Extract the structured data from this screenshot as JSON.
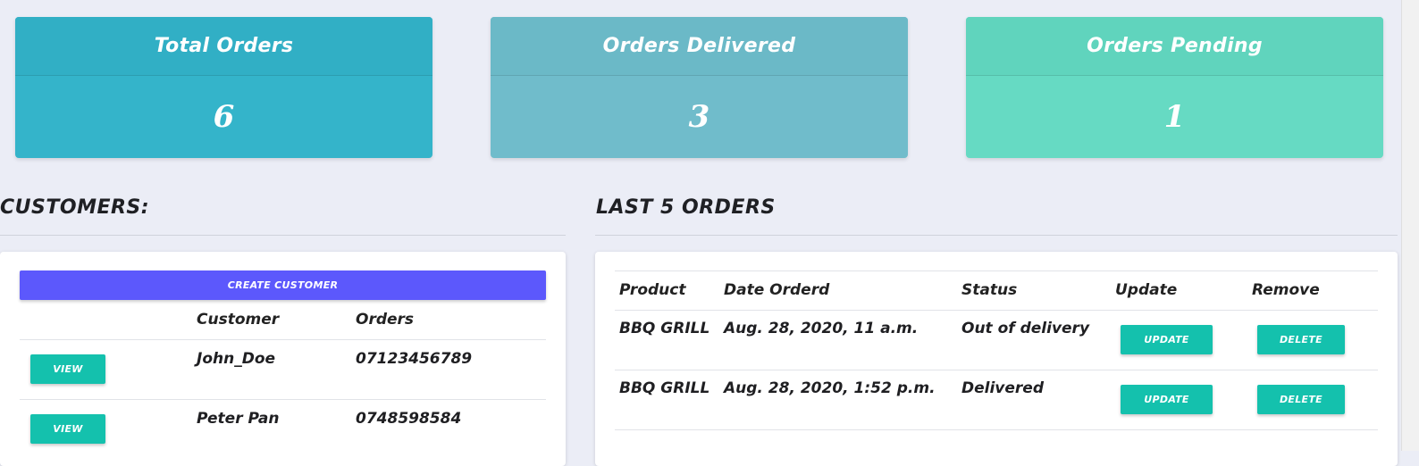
{
  "stats": {
    "total": {
      "label": "Total Orders",
      "value": "6"
    },
    "delivered": {
      "label": "Orders Delivered",
      "value": "3"
    },
    "pending": {
      "label": "Orders Pending",
      "value": "1"
    }
  },
  "customers": {
    "title": "CUSTOMERS:",
    "create_label": "CREATE CUSTOMER",
    "columns": [
      "Customer",
      "Orders"
    ],
    "view_label": "VIEW",
    "rows": [
      {
        "name": "John_Doe",
        "orders": "07123456789"
      },
      {
        "name": "Peter Pan",
        "orders": "0748598584"
      }
    ]
  },
  "orders": {
    "title": "LAST 5 ORDERS",
    "columns": [
      "Product",
      "Date Orderd",
      "Status",
      "Update",
      "Remove"
    ],
    "update_label": "UPDATE",
    "delete_label": "DELETE",
    "rows": [
      {
        "product": "BBQ GRILL",
        "date": "Aug. 28, 2020, 11 a.m.",
        "status": "Out of delivery"
      },
      {
        "product": "BBQ GRILL",
        "date": "Aug. 28, 2020, 1:52 p.m.",
        "status": "Delivered"
      }
    ]
  },
  "colors": {
    "create_button": "#5c58fc",
    "action_button": "#14c1ad",
    "total_card": "#34b4ca",
    "delivered_card": "#70bccb",
    "pending_card": "#66dac3"
  }
}
